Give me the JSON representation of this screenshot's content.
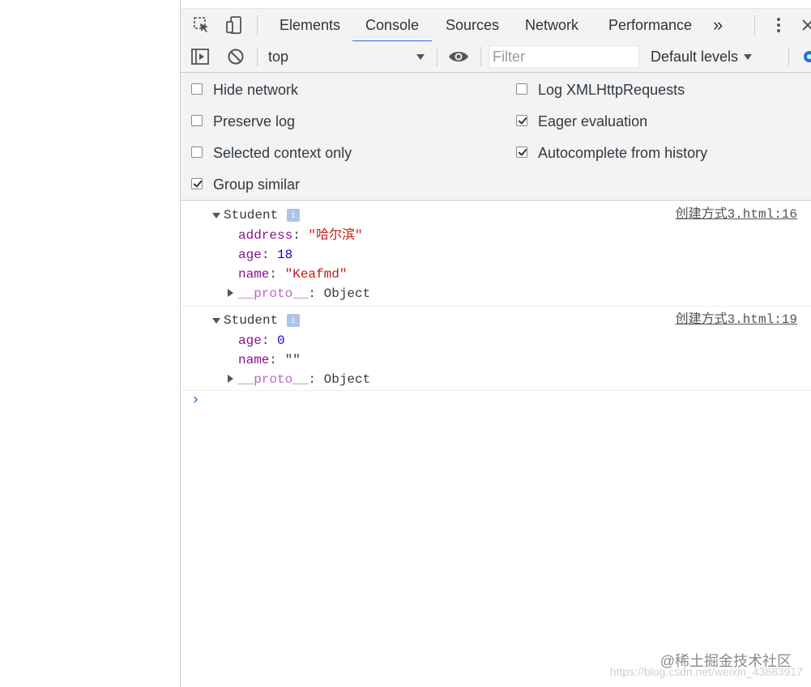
{
  "tabs": [
    "Elements",
    "Console",
    "Sources",
    "Network",
    "Performance"
  ],
  "tab_overflow": "»",
  "console_toolbar": {
    "context": "top",
    "filter_placeholder": "Filter",
    "levels": "Default levels"
  },
  "settings": {
    "left": [
      {
        "label": "Hide network",
        "checked": false
      },
      {
        "label": "Preserve log",
        "checked": false
      },
      {
        "label": "Selected context only",
        "checked": false
      },
      {
        "label": "Group similar",
        "checked": true
      }
    ],
    "right": [
      {
        "label": "Log XMLHttpRequests",
        "checked": false
      },
      {
        "label": "Eager evaluation",
        "checked": true
      },
      {
        "label": "Autocomplete from history",
        "checked": true
      }
    ]
  },
  "messages": [
    {
      "title": "Student",
      "source": "创建方式3.html:16",
      "props": [
        {
          "key": "address",
          "value": "\"哈尔滨\"",
          "type": "string"
        },
        {
          "key": "age",
          "value": "18",
          "type": "number"
        },
        {
          "key": "name",
          "value": "\"Keafmd\"",
          "type": "string"
        }
      ],
      "proto": {
        "key": "__proto__",
        "value": "Object"
      }
    },
    {
      "title": "Student",
      "source": "创建方式3.html:19",
      "props": [
        {
          "key": "age",
          "value": "0",
          "type": "number"
        },
        {
          "key": "name",
          "value": "\"\"",
          "type": "plain"
        }
      ],
      "proto": {
        "key": "__proto__",
        "value": "Object"
      }
    }
  ],
  "prompt_symbol": "›",
  "watermark": {
    "line1": "@稀土掘金技术社区",
    "line2": "https://blog.csdn.net/weixin_43883917"
  },
  "icons": [
    "inspect-element-icon",
    "device-toggle-icon",
    "more-tabs-icon",
    "kebab-menu-icon",
    "close-icon",
    "sidebar-toggle-icon",
    "clear-console-icon",
    "dropdown-arrow-icon",
    "eye-icon",
    "settings-gear-icon",
    "info-icon",
    "expand-triangle-icon"
  ],
  "colors": {
    "accent": "#1a73e8",
    "key": "#881391",
    "number": "#1c00cf",
    "string": "#c41a16"
  }
}
